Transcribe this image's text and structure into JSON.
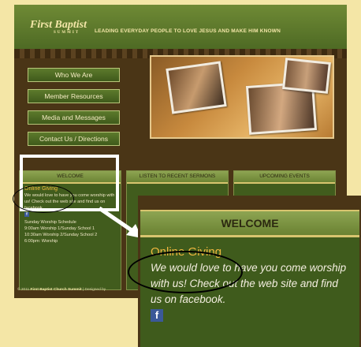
{
  "header": {
    "logo_text": "First Baptist",
    "logo_sub": "SUMMIT",
    "tagline": "LEADING EVERYDAY PEOPLE TO LOVE JESUS AND MAKE HIM KNOWN"
  },
  "nav": {
    "items": [
      {
        "label": "Who We Are"
      },
      {
        "label": "Member Resources"
      },
      {
        "label": "Media and Messages"
      },
      {
        "label": "Contact Us / Directions"
      }
    ]
  },
  "columns": {
    "welcome": {
      "heading": "WELCOME",
      "online_giving": "Online Giving",
      "intro": "We would love to have you come worship with us! Check out the web site and find us on facebook.",
      "facebook_glyph": "f",
      "schedule_title": "Sunday Worship Schedule",
      "schedule_line1": "9:00am Worship 1/Sunday School 1",
      "schedule_line2": "10:30am Worship 2/Sunday School 2",
      "schedule_line3": "6:00pm: Worship"
    },
    "sermons": {
      "heading": "LISTEN TO RECENT SERMONS"
    },
    "events": {
      "heading": "UPCOMING EVENTS"
    }
  },
  "footer": {
    "copyright": "© 2011",
    "church_name": "First Baptist Church Summit",
    "designed_by": "| Designed by"
  },
  "zoom": {
    "heading": "WELCOME",
    "online_giving": "Online Giving",
    "body": "We would love to have you come worship with us! Check out the web site and find us on facebook.",
    "facebook_glyph": "f"
  },
  "colors": {
    "page_background": "#f4e6a6",
    "site_brown": "#4a3516",
    "green_panel": "#415c1d",
    "online_giving_orange": "#f0b73f",
    "facebook_blue": "#3b5998",
    "highlight_box": "#ffffff"
  }
}
